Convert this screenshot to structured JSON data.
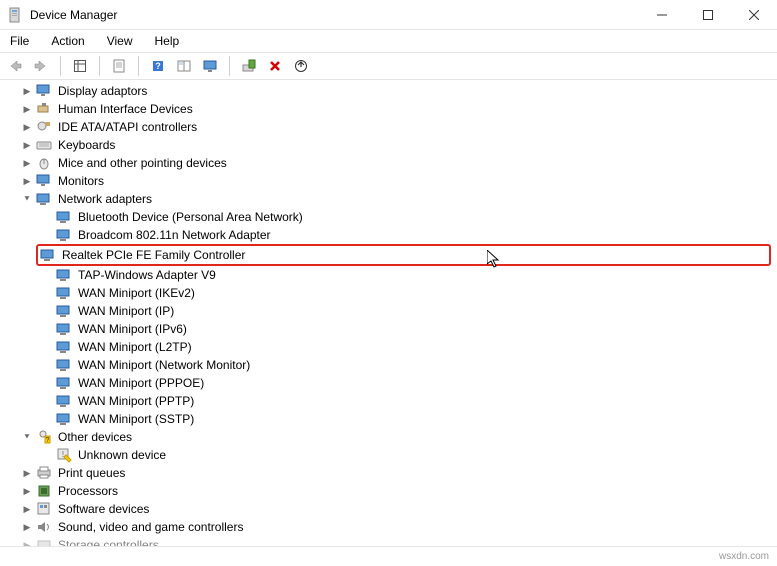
{
  "window": {
    "title": "Device Manager"
  },
  "menubar": {
    "file": "File",
    "action": "Action",
    "view": "View",
    "help": "Help"
  },
  "tree": {
    "display_adaptors": "Display adaptors",
    "hid": "Human Interface Devices",
    "ide": "IDE ATA/ATAPI controllers",
    "keyboards": "Keyboards",
    "mice": "Mice and other pointing devices",
    "monitors": "Monitors",
    "network_adapters": "Network adapters",
    "net_children": {
      "bluetooth": "Bluetooth Device (Personal Area Network)",
      "broadcom": "Broadcom 802.11n Network Adapter",
      "realtek": "Realtek PCIe FE Family Controller",
      "tap": "TAP-Windows Adapter V9",
      "wan_ikev2": "WAN Miniport (IKEv2)",
      "wan_ip": "WAN Miniport (IP)",
      "wan_ipv6": "WAN Miniport (IPv6)",
      "wan_l2tp": "WAN Miniport (L2TP)",
      "wan_netmon": "WAN Miniport (Network Monitor)",
      "wan_pppoe": "WAN Miniport (PPPOE)",
      "wan_pptp": "WAN Miniport (PPTP)",
      "wan_sstp": "WAN Miniport (SSTP)"
    },
    "other_devices": "Other devices",
    "unknown_device": "Unknown device",
    "print_queues": "Print queues",
    "processors": "Processors",
    "software_devices": "Software devices",
    "sound": "Sound, video and game controllers",
    "storage": "Storage controllers"
  },
  "statusbar": {
    "watermark": "wsxdn.com"
  }
}
